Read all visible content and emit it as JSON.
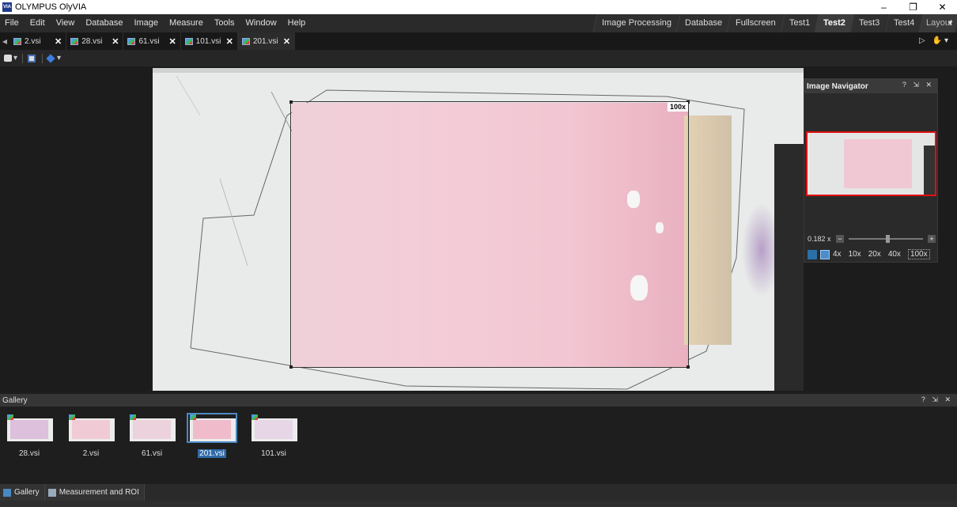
{
  "window": {
    "title": "OLYMPUS OlyVIA",
    "logo_text": "VIA",
    "min_glyph": "–",
    "max_glyph": "❐",
    "close_glyph": "✕"
  },
  "menu": [
    "File",
    "Edit",
    "View",
    "Database",
    "Image",
    "Measure",
    "Tools",
    "Window",
    "Help"
  ],
  "layout_tabs": {
    "items": [
      "Image Processing",
      "Database",
      "Fullscreen",
      "Test1",
      "Test2",
      "Test3",
      "Test4"
    ],
    "active": "Test2",
    "layout_label": "Layout"
  },
  "doc_tabs": {
    "items": [
      "2.vsi",
      "28.vsi",
      "61.vsi",
      "101.vsi",
      "201.vsi"
    ],
    "active": "201.vsi",
    "close_glyph": "✕"
  },
  "viewer": {
    "zoom_tag": "100x"
  },
  "navigator": {
    "title": "Image Navigator",
    "controls": "? ⇲ ✕",
    "zoom_value": "0.182 x",
    "zoom_fraction": 0.5,
    "magnifications": [
      "4x",
      "10x",
      "20x",
      "40x",
      "100x"
    ],
    "selected_magnification": "100x"
  },
  "gallery": {
    "title": "Gallery",
    "controls": "? ⇲ ✕",
    "items": [
      {
        "label": "28.vsi",
        "tissue_color": "#dcc0dc"
      },
      {
        "label": "2.vsi",
        "tissue_color": "#f0cbd6"
      },
      {
        "label": "61.vsi",
        "tissue_color": "#ecd2dc"
      },
      {
        "label": "201.vsi",
        "tissue_color": "#f0bccb"
      },
      {
        "label": "101.vsi",
        "tissue_color": "#e6d6e6"
      }
    ],
    "selected": "201.vsi"
  },
  "bottom_tabs": [
    "Gallery",
    "Measurement and ROI"
  ],
  "colors": {
    "accent": "#4c8ac4",
    "navigator_frame": "#e01010"
  }
}
